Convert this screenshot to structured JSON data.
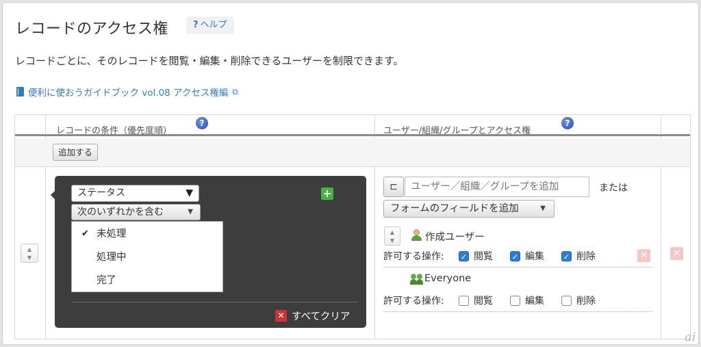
{
  "page": {
    "title": "レコードのアクセス権",
    "help_label": "ヘルプ",
    "help_q": "?",
    "description": "レコードごとに、そのレコードを閲覧・編集・削除できるユーザーを制限できます。",
    "guide_link": "便利に使おうガイドブック vol.08 アクセス権編",
    "watermark": "ai"
  },
  "table": {
    "header_condition": "レコードの条件（優先度順）",
    "header_permission": "ユーザー/組織/グループとアクセス権",
    "add_button": "追加する"
  },
  "condition": {
    "field_select": "ステータス",
    "operator_select": "次のいずれかを含む",
    "options": [
      {
        "label": "未処理",
        "checked": true
      },
      {
        "label": "処理中",
        "checked": false
      },
      {
        "label": "完了",
        "checked": false
      }
    ],
    "clear_all": "すべてクリア"
  },
  "permission": {
    "user_input_placeholder": "ユーザー／組織／グループを追加",
    "or_text": "または",
    "form_field_button": "フォームのフィールドを追加",
    "allowed_ops_label": "許可する操作:",
    "entries": [
      {
        "name": "作成ユーザー",
        "icon": "user-icon",
        "ops": [
          {
            "label": "閲覧",
            "checked": true
          },
          {
            "label": "編集",
            "checked": true
          },
          {
            "label": "削除",
            "checked": true
          }
        ]
      },
      {
        "name": "Everyone",
        "icon": "group-icon",
        "ops": [
          {
            "label": "閲覧",
            "checked": false
          },
          {
            "label": "編集",
            "checked": false
          },
          {
            "label": "削除",
            "checked": false
          }
        ]
      }
    ]
  },
  "colors": {
    "accent": "#3a7ab8",
    "checkbox_on": "#2f7bd8",
    "add_green": "#4bb043",
    "delete_red": "#c8343a"
  }
}
